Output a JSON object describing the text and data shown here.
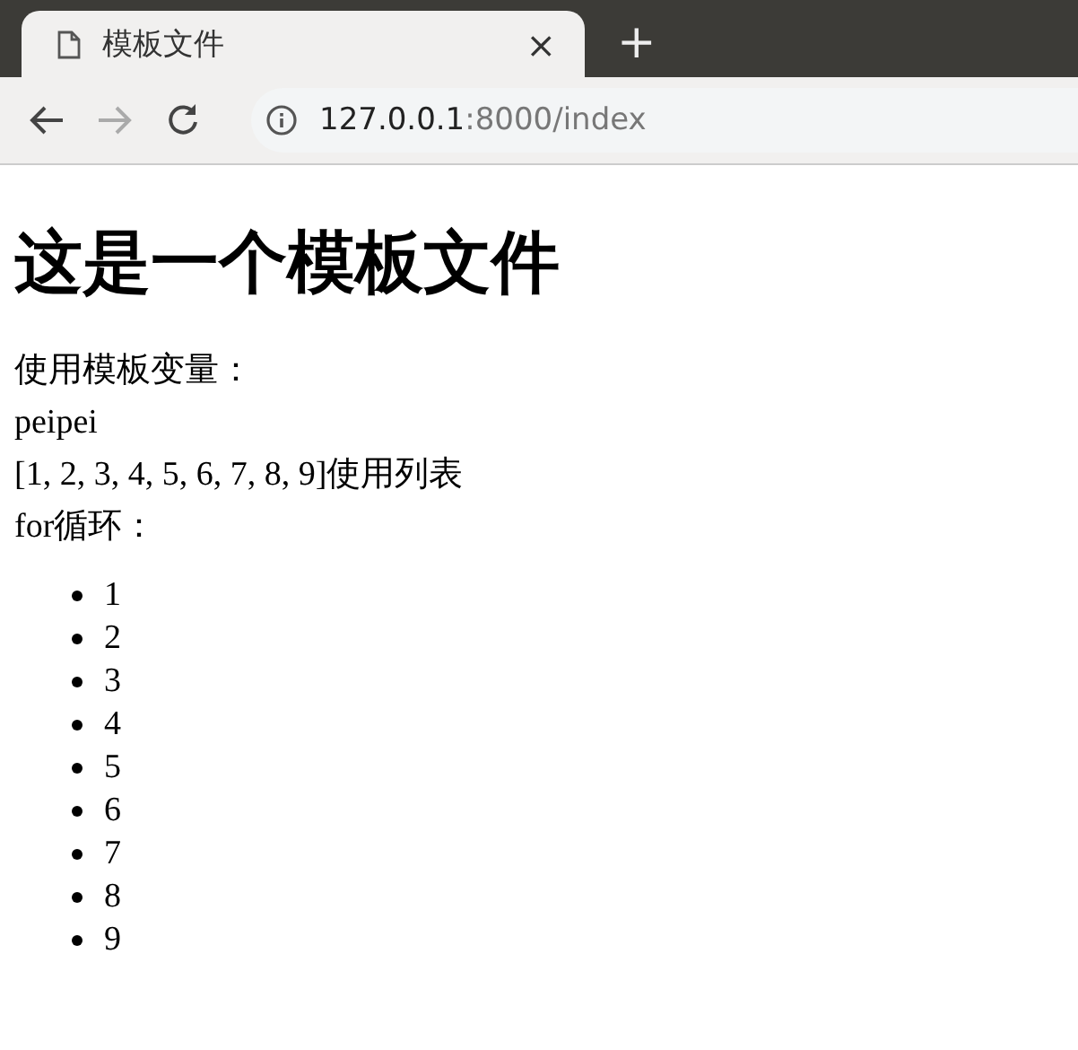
{
  "tab": {
    "title": "模板文件",
    "close": "×"
  },
  "new_tab": "+",
  "toolbar": {
    "back": {
      "disabled": false
    },
    "forward": {
      "disabled": true
    }
  },
  "address": {
    "host": "127.0.0.1",
    "path": ":8000/index"
  },
  "page": {
    "heading": "这是一个模板文件",
    "lines": [
      "使用模板变量：",
      "peipei",
      "[1, 2, 3, 4, 5, 6, 7, 8, 9]使用列表",
      "for循环："
    ],
    "list": [
      "1",
      "2",
      "3",
      "4",
      "5",
      "6",
      "7",
      "8",
      "9"
    ]
  }
}
